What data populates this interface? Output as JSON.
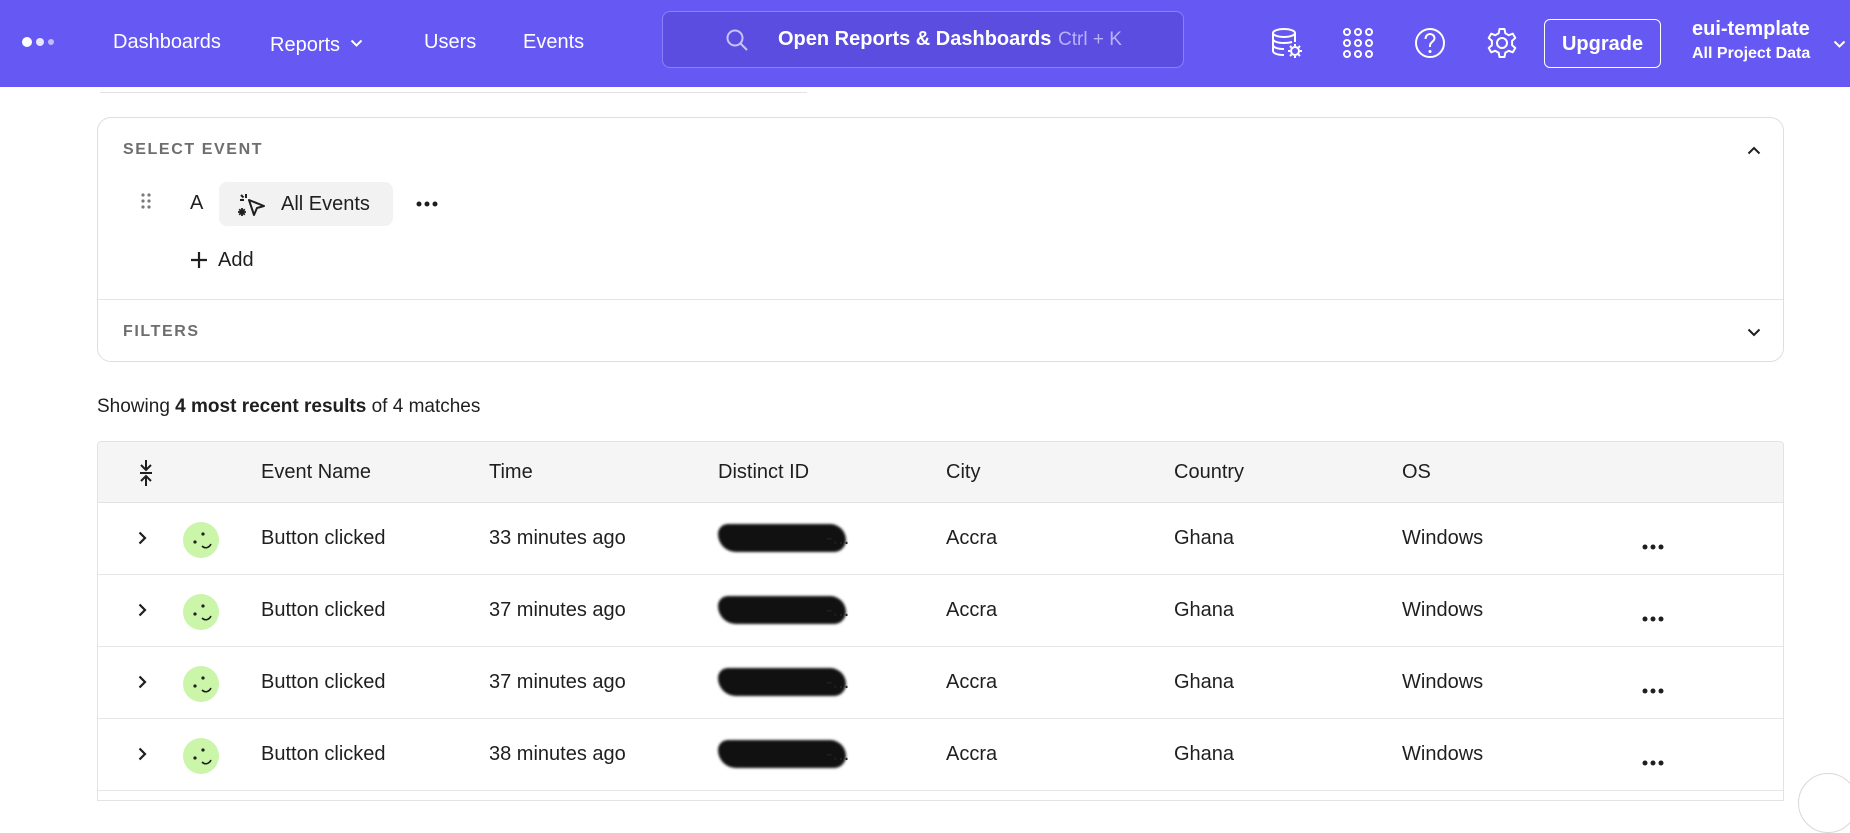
{
  "nav": {
    "links": {
      "dashboards": "Dashboards",
      "reports": "Reports",
      "users": "Users",
      "events": "Events"
    },
    "search": {
      "label": "Open Reports & Dashboards",
      "shortcut": "Ctrl + K"
    },
    "upgrade_label": "Upgrade",
    "project": {
      "name": "eui-template",
      "scope": "All Project Data"
    },
    "icons": [
      "logo-icon",
      "chevron-down-icon",
      "search-icon",
      "data-settings-icon",
      "apps-grid-icon",
      "help-icon",
      "gear-icon"
    ],
    "accent_color": "#6658f3"
  },
  "query": {
    "select_event_title": "SELECT EVENT",
    "row_letter": "A",
    "event_chip_label": "All Events",
    "add_label": "Add",
    "filters_title": "FILTERS"
  },
  "summary": {
    "prefix": "Showing",
    "bold": "4 most recent results",
    "suffix": "of 4 matches"
  },
  "table": {
    "columns": [
      "Event Name",
      "Time",
      "Distinct ID",
      "City",
      "Country",
      "OS"
    ],
    "rows": [
      {
        "event_name": "Button clicked",
        "time": "33 minutes ago",
        "distinct_id_tail": "-...",
        "city": "Accra",
        "country": "Ghana",
        "os": "Windows"
      },
      {
        "event_name": "Button clicked",
        "time": "37 minutes ago",
        "distinct_id_tail": "-...",
        "city": "Accra",
        "country": "Ghana",
        "os": "Windows"
      },
      {
        "event_name": "Button clicked",
        "time": "37 minutes ago",
        "distinct_id_tail": "-...",
        "city": "Accra",
        "country": "Ghana",
        "os": "Windows"
      },
      {
        "event_name": "Button clicked",
        "time": "38 minutes ago",
        "distinct_id_tail": "-...",
        "city": "Accra",
        "country": "Ghana",
        "os": "Windows"
      }
    ],
    "avatar_color": "#cbf5a9"
  }
}
